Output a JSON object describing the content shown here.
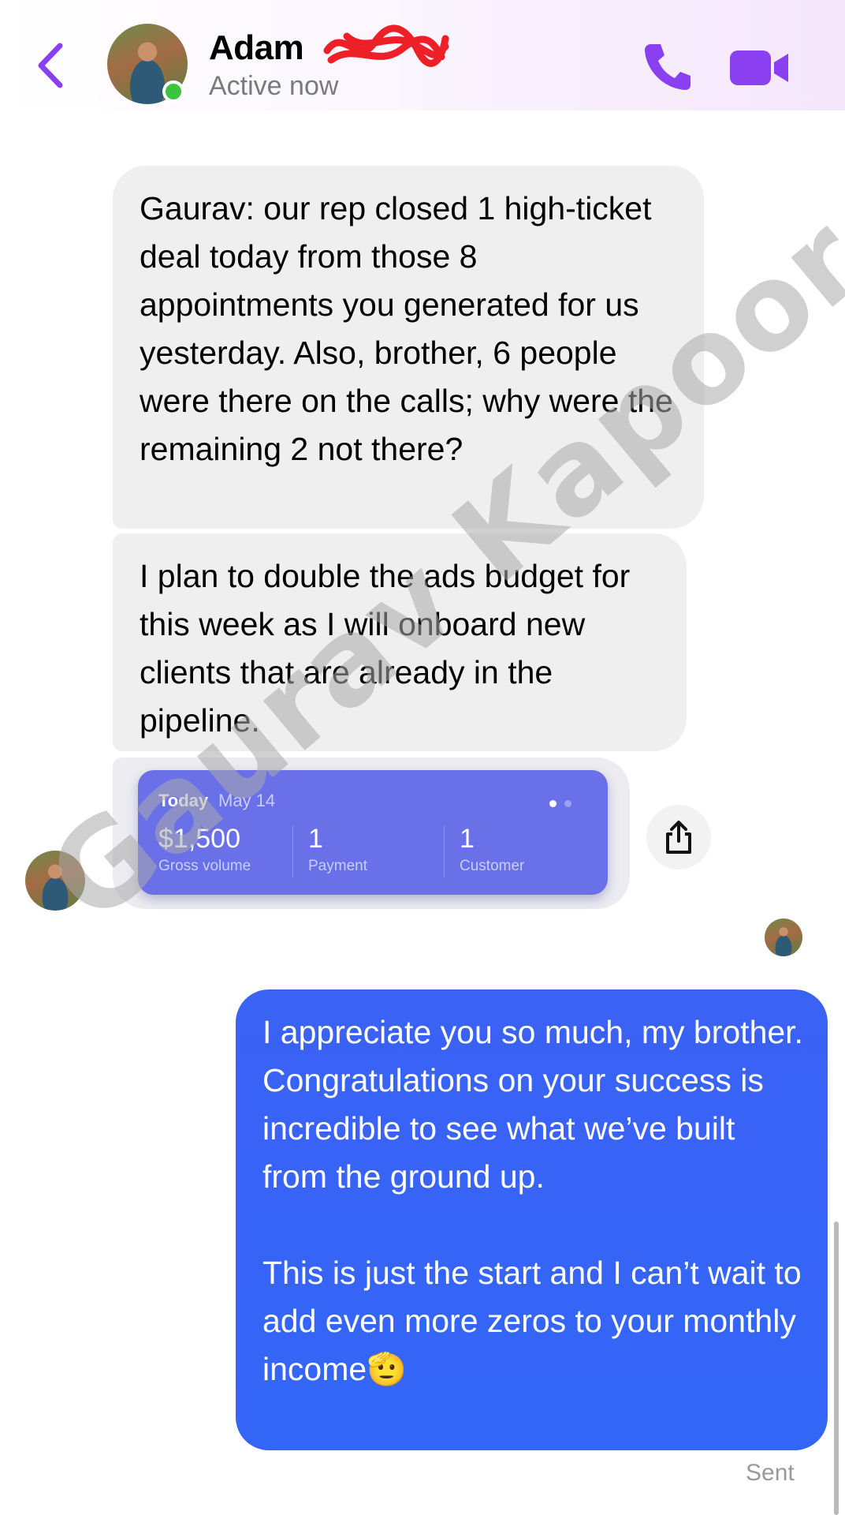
{
  "header": {
    "contact_name": "Adam",
    "status": "Active now",
    "colors": {
      "accent": "#8a3ff0",
      "online": "#3bc43e"
    }
  },
  "messages": {
    "received": [
      "Gaurav: our rep closed 1 high-ticket deal today from those 8 appointments you generated for us yesterday. Also, brother, 6 people were there on the calls; why were the remaining 2 not there?",
      "I plan to double the ads budget for this week as I will onboard new clients that are already in the pipeline."
    ],
    "sent_paragraphs": [
      "I appreciate you so much, my brother. Congratulations on your success is incredible to see what we’ve built from the ground up.",
      "This is just the start and I can’t wait to add even more zeros to your monthly income🫡"
    ],
    "sent_status": "Sent"
  },
  "card": {
    "day_label": "Today",
    "date": "May 14",
    "metrics": [
      {
        "value": "$1,500",
        "label": "Gross volume"
      },
      {
        "value": "1",
        "label": "Payment"
      },
      {
        "value": "1",
        "label": "Customer"
      }
    ],
    "colors": {
      "background": "#6a71e8"
    }
  },
  "watermark": "Gaurav Kapoor",
  "icons": [
    "chevron-left-icon",
    "phone-icon",
    "video-camera-icon",
    "share-icon"
  ]
}
